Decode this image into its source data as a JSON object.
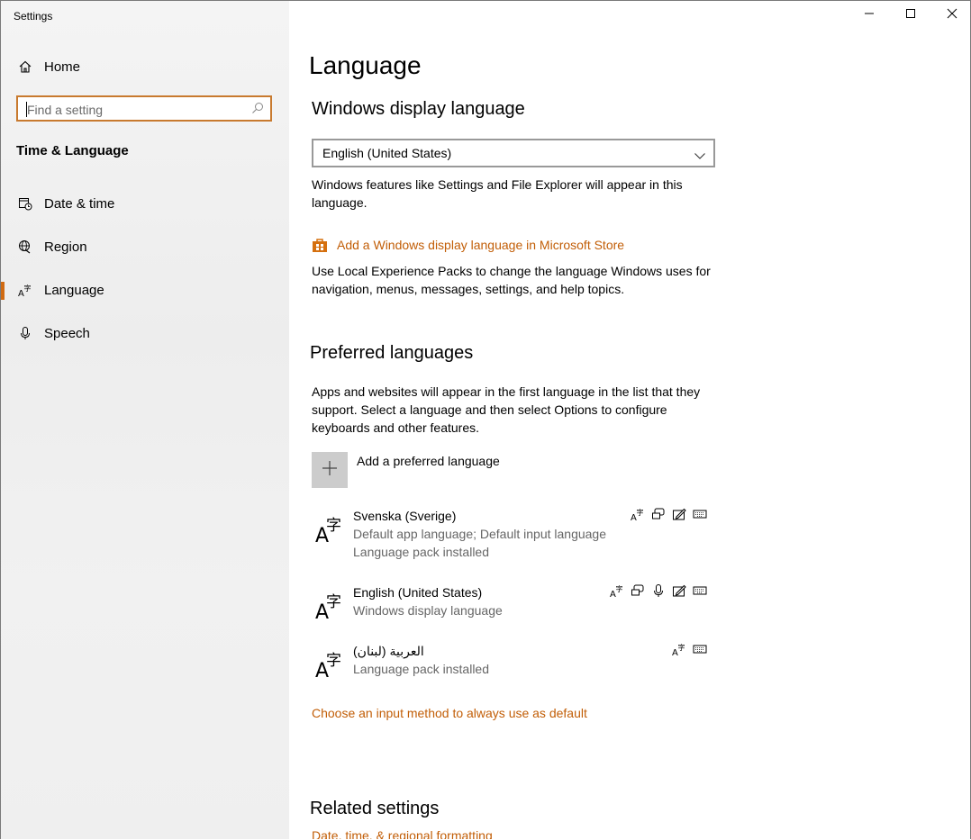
{
  "window": {
    "title": "Settings",
    "controls": {
      "minimize": "minimize-icon",
      "maximize": "maximize-icon",
      "close": "close-icon"
    }
  },
  "sidebar": {
    "home_label": "Home",
    "search_placeholder": "Find a setting",
    "section": "Time & Language",
    "items": [
      {
        "label": "Date & time",
        "icon": "date-time-icon"
      },
      {
        "label": "Region",
        "icon": "globe-icon"
      },
      {
        "label": "Language",
        "icon": "language-icon",
        "active": true
      },
      {
        "label": "Speech",
        "icon": "microphone-icon"
      }
    ]
  },
  "main": {
    "title": "Language",
    "display_language": {
      "heading": "Windows display language",
      "selected": "English (United States)",
      "description": "Windows features like Settings and File Explorer will appear in this language.",
      "store_link": "Add a Windows display language in Microsoft Store",
      "store_description": "Use Local Experience Packs to change the language Windows uses for navigation, menus, messages, settings, and help topics."
    },
    "preferred": {
      "heading": "Preferred languages",
      "description": "Apps and websites will appear in the first language in the list that they support. Select a language and then select Options to configure keyboards and other features.",
      "add_label": "Add a preferred language",
      "languages": [
        {
          "name": "Svenska (Sverige)",
          "details": [
            "Default app language; Default input language",
            "Language pack installed"
          ],
          "features": [
            "language-pack-icon",
            "speech-bubble-icon",
            "handwriting-icon",
            "keyboard-icon"
          ]
        },
        {
          "name": "English (United States)",
          "details": [
            "Windows display language"
          ],
          "features": [
            "language-pack-icon",
            "speech-bubble-icon",
            "microphone-icon",
            "handwriting-icon",
            "keyboard-icon"
          ]
        },
        {
          "name": "العربية (لبنان)",
          "details": [
            "Language pack installed"
          ],
          "features": [
            "language-pack-icon",
            "keyboard-icon"
          ]
        }
      ],
      "input_method_link": "Choose an input method to always use as default"
    },
    "related": {
      "heading": "Related settings",
      "link": "Date, time, & regional formatting"
    }
  },
  "colors": {
    "accent": "#c25e07",
    "active_bar": "#d06a12",
    "search_border": "#c87a2f"
  }
}
